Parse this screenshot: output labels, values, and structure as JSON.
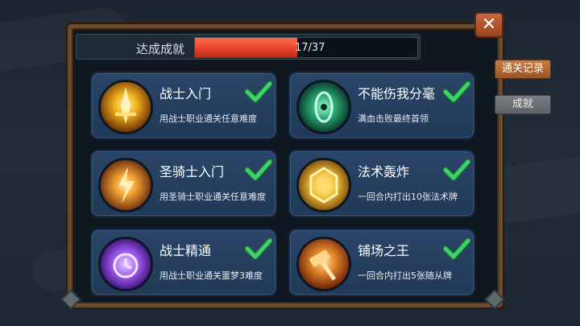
{
  "header": {
    "progress_label": "达成成就",
    "progress_text": "17/37",
    "progress_fraction": 0.4595
  },
  "close_label": "✕",
  "side_tabs": [
    {
      "label": "通关记录",
      "active": false
    },
    {
      "label": "成就",
      "active": true
    }
  ],
  "achievements": [
    {
      "title": "战士入门",
      "desc": "用战士职业通关任意难度",
      "icon": "warrior-sword-icon",
      "completed": true
    },
    {
      "title": "不能伤我分毫",
      "desc": "满血击败最终首领",
      "icon": "green-shield-icon",
      "completed": true
    },
    {
      "title": "圣骑士入门",
      "desc": "用圣骑士职业通关任意难度",
      "icon": "paladin-lightning-icon",
      "completed": true
    },
    {
      "title": "法术轰炸",
      "desc": "一回合内打出10张法术牌",
      "icon": "golden-hexagon-icon",
      "completed": true
    },
    {
      "title": "战士精通",
      "desc": "用战士职业通关噩梦3难度",
      "icon": "purple-clock-icon",
      "completed": true
    },
    {
      "title": "铺场之王",
      "desc": "一回合内打出5张随从牌",
      "icon": "fire-hammer-icon",
      "completed": true
    }
  ],
  "colors": {
    "check": "#3fd16a",
    "progress_fill": "#e8452b",
    "card_bg": "#2a4568",
    "frame": "#6b4a2e"
  }
}
